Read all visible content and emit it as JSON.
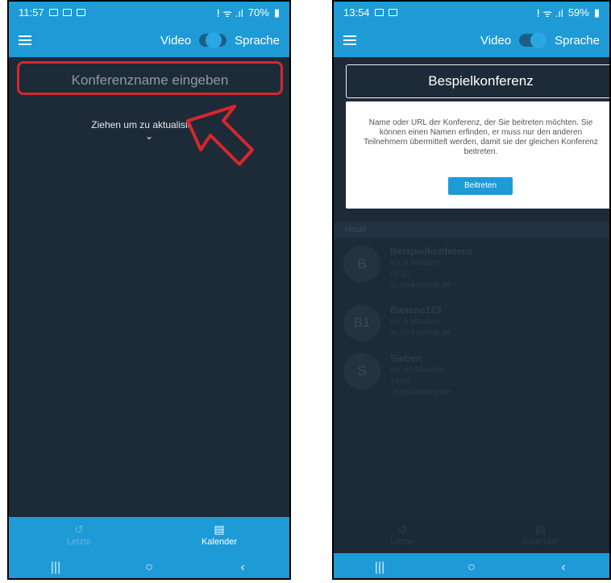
{
  "left": {
    "status": {
      "time": "11:57",
      "battery": "70%"
    },
    "appbar": {
      "video_label": "Video",
      "speech_label": "Sprache"
    },
    "input_placeholder": "Konferenzname eingeben",
    "pull_text": "Ziehen um zu aktualisieren",
    "nav": {
      "recent_label": "Letzte",
      "calendar_label": "Kalender"
    },
    "annotation_color": "#d8262b"
  },
  "right": {
    "status": {
      "time": "13:54",
      "battery": "59%"
    },
    "appbar": {
      "video_label": "Video",
      "speech_label": "Sprache"
    },
    "input_value": "Bespielkonferenz",
    "popup": {
      "text": "Name oder URL der Konferenz, der Sie beitreten möchten. Sie können einen Namen erfinden, er muss nur den anderen Teilnehmern übermittelt werden, damit sie der gleichen Konferenz beitreten.",
      "button": "Beitreten"
    },
    "section_header": "Heute",
    "entries": [
      {
        "avatar": "B",
        "title": "Beispielkonferenz",
        "lines": [
          "vor 5 Minuten",
          "01:31",
          "vc.hs-koblenz.de"
        ]
      },
      {
        "avatar": "B1",
        "title": "Banane123",
        "lines": [
          "vor 5 Minuten",
          "vc.hs-koblenz.de"
        ]
      },
      {
        "avatar": "S",
        "title": "Sieben",
        "lines": [
          "vor 40 Minuten",
          "14:08",
          "vc.hs-koblenz.de"
        ]
      }
    ],
    "nav": {
      "recent_label": "Letzte",
      "calendar_label": "Kalender"
    }
  },
  "colors": {
    "accent": "#1e9bd7",
    "background": "#1d2b38"
  }
}
